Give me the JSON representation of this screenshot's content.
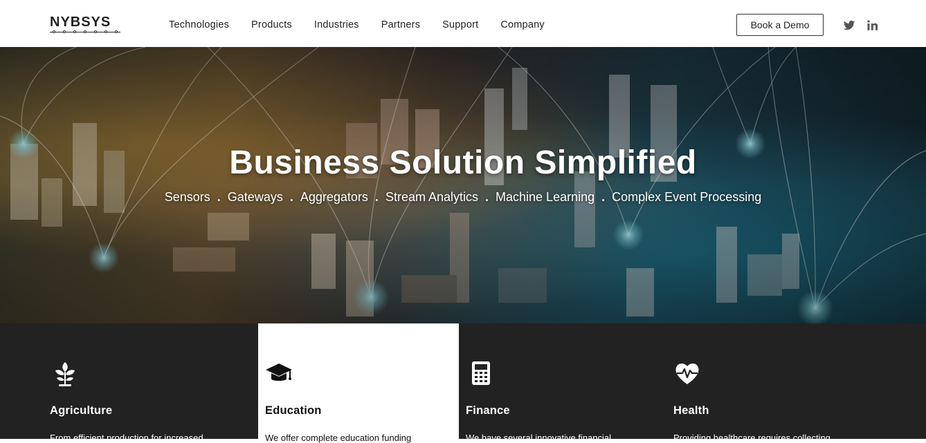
{
  "header": {
    "logo_text": "NYBSYS",
    "nav": [
      "Technologies",
      "Products",
      "Industries",
      "Partners",
      "Support",
      "Company"
    ],
    "cta_label": "Book a Demo",
    "social": [
      "twitter-icon",
      "linkedin-icon"
    ]
  },
  "hero": {
    "title": "Business Solution Simplified",
    "tags": [
      "Sensors",
      "Gateways",
      "Aggregators",
      "Stream Analytics",
      "Machine Learning",
      "Complex Event Processing"
    ],
    "separator": "."
  },
  "industries": [
    {
      "icon": "plant-icon",
      "title": "Agriculture",
      "text": "From efficient production for increased",
      "active": false
    },
    {
      "icon": "graduation-cap-icon",
      "title": "Education",
      "text": "We offer complete education funding",
      "active": true
    },
    {
      "icon": "calculator-icon",
      "title": "Finance",
      "text": "We have several innovative financial",
      "active": false
    },
    {
      "icon": "heart-pulse-icon",
      "title": "Health",
      "text": "Providing healthcare requires collecting",
      "active": false
    }
  ],
  "colors": {
    "dark_band": "#222222",
    "accent_glow": "#8fe3ef"
  }
}
